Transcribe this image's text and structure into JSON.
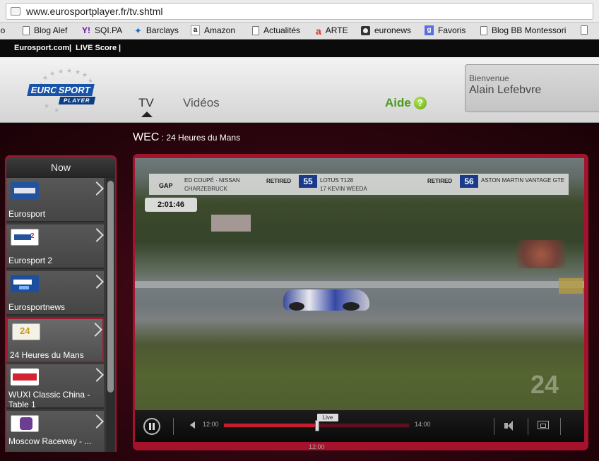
{
  "browser": {
    "url": "www.eurosportplayer.fr/tv.shtml",
    "bookmarks": [
      {
        "label": "éo",
        "icon": "page-icon"
      },
      {
        "label": "Blog Alef",
        "icon": "page-icon"
      },
      {
        "label": "SQI.PA",
        "icon": "yahoo-icon"
      },
      {
        "label": "Barclays",
        "icon": "barclays-icon"
      },
      {
        "label": "Amazon",
        "icon": "amazon-icon"
      },
      {
        "label": "Actualités",
        "icon": "page-icon"
      },
      {
        "label": "ARTE",
        "icon": "arte-icon"
      },
      {
        "label": "euronews",
        "icon": "euronews-icon"
      },
      {
        "label": "Favoris",
        "icon": "google-icon"
      },
      {
        "label": "Blog BB Montessori",
        "icon": "page-icon"
      }
    ]
  },
  "sitebar": {
    "eurosport": "Eurosport.com",
    "sep1": "|",
    "livescore": "LIVE Score",
    "sep2": "|"
  },
  "header": {
    "logo_euro": "EURO",
    "logo_sport": "SPORT",
    "logo_player": "PLAYER",
    "nav_tv": "TV",
    "nav_videos": "Vidéos",
    "nav_aide": "Aide",
    "help_glyph": "?",
    "welcome": "Bienvenue",
    "username": "Alain Lefebvre"
  },
  "channel": {
    "code": "WEC",
    "separator": " : ",
    "title": "24 Heures du Mans"
  },
  "sidebar": {
    "heading": "Now",
    "items": [
      {
        "label": "Eurosport",
        "thumb": "es"
      },
      {
        "label": "Eurosport 2",
        "thumb": "es2"
      },
      {
        "label": "Eurosportnews",
        "thumb": "esn"
      },
      {
        "label": "24 Heures du Mans",
        "thumb": "lm",
        "active": true
      },
      {
        "label": "WUXI Classic China - Table 1",
        "thumb": "wx"
      },
      {
        "label": "Moscow Raceway - ...",
        "thumb": "mr"
      }
    ]
  },
  "video_overlay": {
    "gap": "GAP",
    "team1_line1": "ED COUPÉ · NISSAN",
    "team1_line2": "CHARZEBRUCK",
    "retired1": "RETIRED",
    "car1_number": "55",
    "car1_line1": "LOTUS T128",
    "car1_line2": "17 KEVIN WEEDA",
    "retired2": "RETIRED",
    "car2_number": "56",
    "car2_line1": "ASTON MARTIN VANTAGE GTE",
    "elapsed": "2:01:46",
    "watermark": "24"
  },
  "player": {
    "start_time": "12:00",
    "end_time": "14:00",
    "current_time": "12:00",
    "live_label": "Live",
    "progress_fraction": 0.5
  },
  "colors": {
    "accent_red": "#a4122c",
    "aide_green": "#4a9a1d",
    "eurosport_blue": "#1753a8"
  }
}
